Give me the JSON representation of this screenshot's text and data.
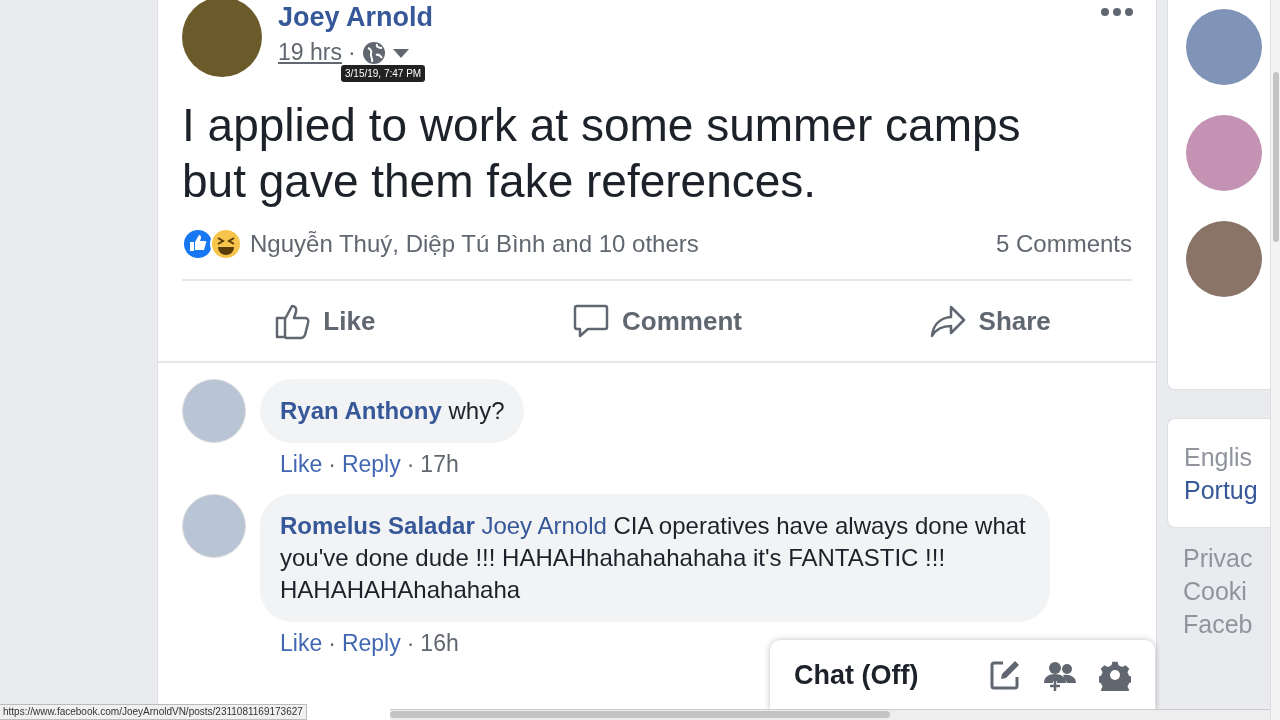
{
  "post": {
    "author": "Joey Arnold",
    "time": "19 hrs",
    "time_separator": "·",
    "tooltip": "3/15/19, 7:47 PM",
    "text": "I applied to work at some summer camps but gave them fake references.",
    "reactions_summary": "Nguyễn Thuý, Diệp Tú Bình and 10 others",
    "comments_count": "5 Comments",
    "actions": [
      {
        "kind": "like",
        "label": "Like"
      },
      {
        "kind": "comment",
        "label": "Comment"
      },
      {
        "kind": "share",
        "label": "Share"
      }
    ]
  },
  "comments": [
    {
      "author": "Ryan Anthony",
      "text": "why?",
      "like": "Like",
      "reply": "Reply",
      "time": "17h",
      "separator": "·"
    },
    {
      "author": "Romelus Saladar",
      "mention": "Joey Arnold",
      "text": "CIA operatives have always done what you've done dude !!! HAHAHhahahahahaha it's FANTASTIC !!! HAHAHAHAhahahaha",
      "like": "Like",
      "reply": "Reply",
      "time": "16h",
      "separator": "·"
    }
  ],
  "sidebar": {
    "language": {
      "current": "Englis",
      "other": "Portug"
    },
    "footer_links": [
      "Privac",
      "Cooki",
      "Faceb"
    ]
  },
  "chat": {
    "label": "Chat (Off)"
  },
  "status_url": "https://www.facebook.com/JoeyArnoldVN/posts/2311081169173627"
}
